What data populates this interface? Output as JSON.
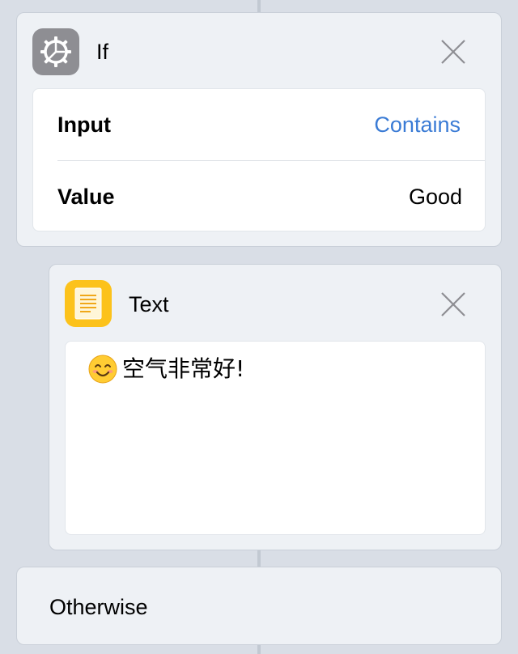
{
  "if_block": {
    "title": "If",
    "icon": "gear-icon",
    "rows": [
      {
        "label": "Input",
        "value": "Contains"
      },
      {
        "label": "Value",
        "value": "Good"
      }
    ]
  },
  "text_block": {
    "title": "Text",
    "icon": "document-icon",
    "emoji": "smiling-face-icon",
    "content": "空气非常好!"
  },
  "otherwise_block": {
    "label": "Otherwise"
  },
  "colors": {
    "background": "#d9dee6",
    "card": "#eef1f5",
    "link": "#3a7bd5",
    "gear_icon_bg": "#8e8e93",
    "text_icon_bg": "#fcc21b"
  }
}
